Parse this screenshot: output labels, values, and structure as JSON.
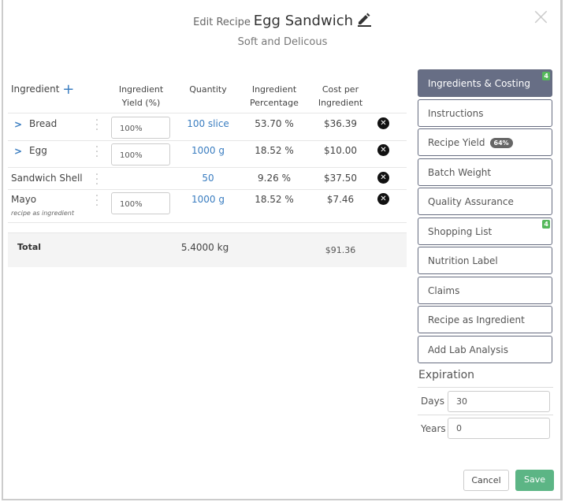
{
  "header": {
    "prefix": "Edit Recipe",
    "recipe_name": "Egg Sandwich",
    "subtitle": "Soft and Delicous",
    "close": "×"
  },
  "table": {
    "columns": [
      "Ingredient",
      "Ingredient Yield (%)",
      "Quantity",
      "Ingredient Percentage",
      "Cost per Ingredient"
    ],
    "col_lines": [
      [
        "Ingredient"
      ],
      [
        "Ingredient",
        "Yield (%)"
      ],
      [
        "Quantity"
      ],
      [
        "Ingredient",
        "Percentage"
      ],
      [
        "Cost per",
        "Ingredient"
      ]
    ],
    "rows": [
      {
        "name": "Bread",
        "expandable": true,
        "yield": "100%",
        "quantity": "100 slice",
        "percentage": "53.70 %",
        "cost": "$36.39"
      },
      {
        "name": "Egg",
        "expandable": true,
        "yield": "100%",
        "quantity": "1000 g",
        "percentage": "18.52 %",
        "cost": "$10.00"
      },
      {
        "name": "Sandwich Shell",
        "expandable": false,
        "quantity": "50",
        "percentage": "9.26 %",
        "cost": "$37.50"
      },
      {
        "name": "Mayo",
        "note": "recipe as ingredient",
        "expandable": false,
        "yield": "100%",
        "quantity": "1000 g",
        "percentage": "18.52 %",
        "cost": "$7.46"
      }
    ],
    "total": {
      "label": "Total",
      "quantity": "5.4000 kg",
      "cost": "$91.36"
    }
  },
  "sidebar": {
    "items": [
      {
        "label": "Ingredients & Costing",
        "badge": "4",
        "active": true
      },
      {
        "label": "Instructions"
      },
      {
        "label": "Recipe Yield",
        "pill": "64%"
      },
      {
        "label": "Batch Weight"
      },
      {
        "label": "Quality Assurance"
      },
      {
        "label": "Shopping List",
        "badge": "4"
      },
      {
        "label": "Nutrition Label"
      },
      {
        "label": "Claims"
      },
      {
        "label": "Recipe as Ingredient"
      },
      {
        "label": "Add Lab Analysis"
      }
    ]
  },
  "expiration": {
    "title": "Expiration",
    "days_label": "Days",
    "days": "30",
    "years_label": "Years",
    "years": "0"
  },
  "footer": {
    "cancel": "Cancel",
    "save": "Save"
  },
  "colors": {
    "accent": "#3a7dc0",
    "active_tab": "#676e85",
    "badge": "#55b85b",
    "save": "#5cb585"
  }
}
